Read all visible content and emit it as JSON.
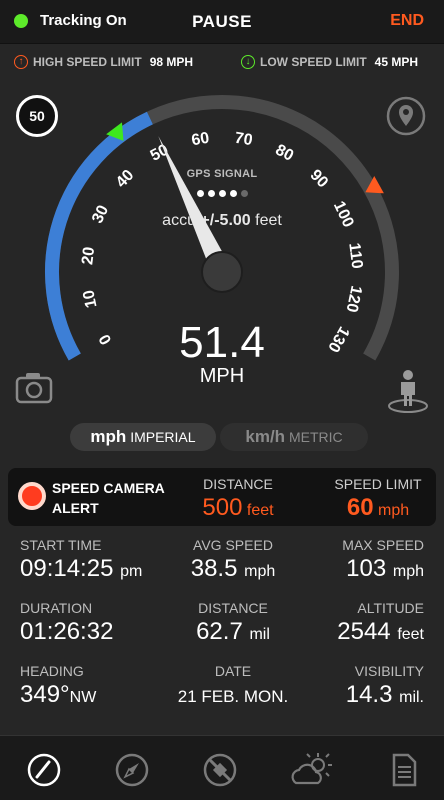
{
  "header": {
    "tracking_label": "Tracking On",
    "pause_label": "PAUSE",
    "end_label": "END"
  },
  "limits": {
    "high_label": "HIGH SPEED LIMIT",
    "high_value": "98 MPH",
    "low_label": "LOW SPEED LIMIT",
    "low_value": "45 MPH"
  },
  "gauge": {
    "speed_limit_badge": "50",
    "ticks": [
      "0",
      "10",
      "20",
      "30",
      "40",
      "50",
      "60",
      "70",
      "80",
      "90",
      "100",
      "110",
      "120",
      "130"
    ],
    "gps_label": "GPS SIGNAL",
    "gps_strength": 4,
    "gps_max": 5,
    "accuracy_prefix": "accu",
    "accuracy_value": "+/-5.00",
    "accuracy_unit": "feet",
    "speed": "51.4",
    "speed_value": 51.4,
    "unit": "MPH",
    "low_marker": 45,
    "high_marker": 98,
    "max": 130
  },
  "units": {
    "imperial_short": "mph",
    "imperial_label": "IMPERIAL",
    "metric_short": "km/h",
    "metric_label": "METRIC"
  },
  "alert": {
    "title": "SPEED CAMERA ALERT",
    "distance_label": "DISTANCE",
    "distance_value": "500",
    "distance_unit": "feet",
    "limit_label": "SPEED LIMIT",
    "limit_value": "60",
    "limit_unit": "mph"
  },
  "stats": {
    "start_time": {
      "label": "START TIME",
      "value": "09:14:25",
      "unit": "pm"
    },
    "avg_speed": {
      "label": "AVG SPEED",
      "value": "38.5",
      "unit": "mph"
    },
    "max_speed": {
      "label": "MAX SPEED",
      "value": "103",
      "unit": "mph"
    },
    "duration": {
      "label": "DURATION",
      "value": "01:26:32",
      "unit": ""
    },
    "distance": {
      "label": "DISTANCE",
      "value": "62.7",
      "unit": "mil"
    },
    "altitude": {
      "label": "ALTITUDE",
      "value": "2544",
      "unit": "feet"
    },
    "heading": {
      "label": "HEADING",
      "value": "349°",
      "unit": "NW"
    },
    "date": {
      "label": "DATE",
      "value": "21 FEB. MON.",
      "unit": ""
    },
    "visibility": {
      "label": "VISIBILITY",
      "value": "14.3",
      "unit": "mil."
    }
  },
  "colors": {
    "accent": "#ff5a1f",
    "gauge_blue": "#3d7fd6",
    "gauge_grey": "#4a4a4a",
    "tracking_green": "#5dea2a"
  },
  "icons": [
    "speedometer-icon",
    "compass-icon",
    "satellite-icon",
    "weather-icon",
    "document-icon",
    "camera-icon",
    "map-pin-icon",
    "person-icon"
  ]
}
